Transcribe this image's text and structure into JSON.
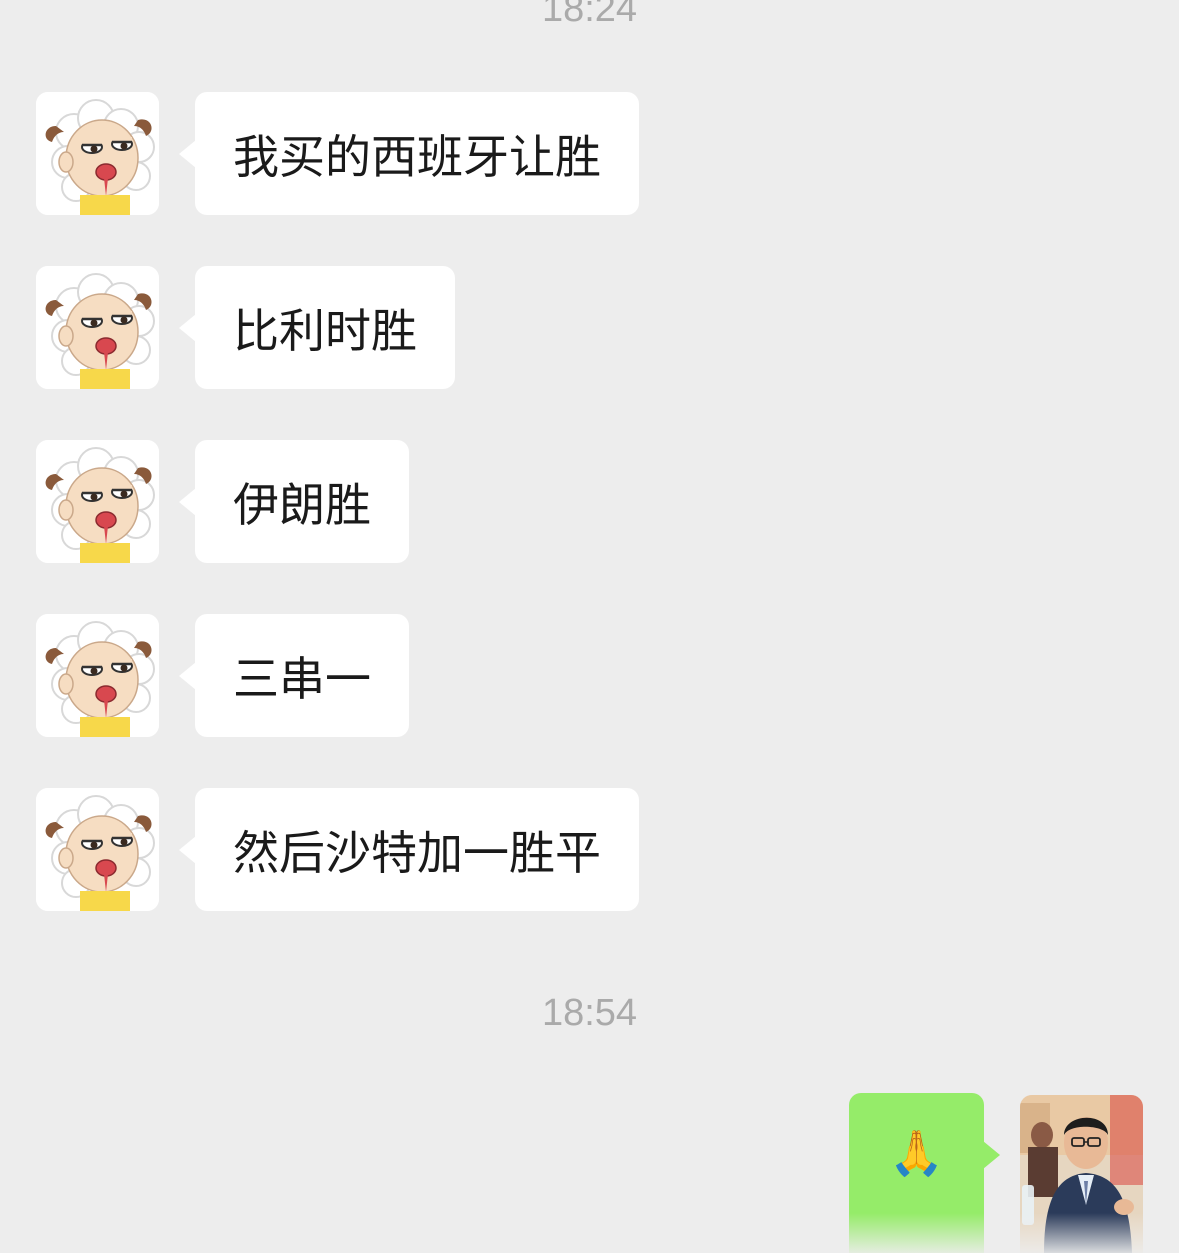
{
  "chat": {
    "timestamps": [
      "18:24",
      "18:54"
    ],
    "messages": [
      {
        "sender": "other",
        "text": "我买的西班牙让胜"
      },
      {
        "sender": "other",
        "text": "比利时胜"
      },
      {
        "sender": "other",
        "text": "伊朗胜"
      },
      {
        "sender": "other",
        "text": "三串一"
      },
      {
        "sender": "other",
        "text": "然后沙特加一胜平"
      }
    ],
    "self_message": {
      "sender": "self",
      "text": "🙏"
    }
  },
  "icons": {
    "other_avatar": "cartoon-sheep-avatar-icon",
    "self_avatar": "man-photo-avatar"
  },
  "colors": {
    "background": "#ededed",
    "other_bubble": "#ffffff",
    "self_bubble": "#95ec69",
    "timestamp": "#aaaaaa"
  }
}
